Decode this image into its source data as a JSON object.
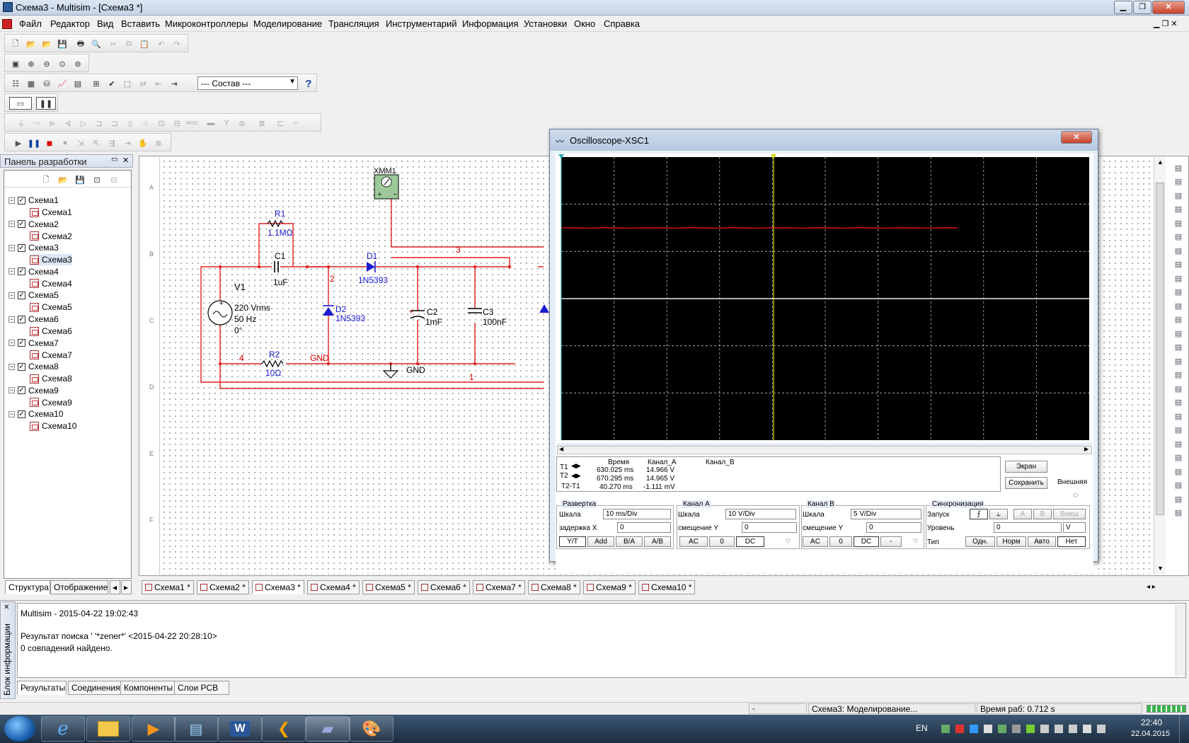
{
  "window": {
    "title": "Схема3 - Multisim - [Схема3 *]"
  },
  "menu": [
    "Файл",
    "Редактор",
    "Вид",
    "Вставить",
    "Микроконтроллеры",
    "Моделирование",
    "Трансляция",
    "Инструментарий",
    "Информация",
    "Установки",
    "Окно",
    "Справка"
  ],
  "toolbar": {
    "usage_select": "--- Состав ---"
  },
  "design_panel": {
    "title": "Панель разработки",
    "items": [
      {
        "parent": "Схема1",
        "child": "Схема1"
      },
      {
        "parent": "Схема2",
        "child": "Схема2"
      },
      {
        "parent": "Схема3",
        "child": "Схема3"
      },
      {
        "parent": "Схема4",
        "child": "Схема4"
      },
      {
        "parent": "Схема5",
        "child": "Схема5"
      },
      {
        "parent": "Схема6",
        "child": "Схема6"
      },
      {
        "parent": "Схема7",
        "child": "Схема7"
      },
      {
        "parent": "Схема8",
        "child": "Схема8"
      },
      {
        "parent": "Схема9",
        "child": "Схема9"
      },
      {
        "parent": "Схема10",
        "child": "Схема10"
      }
    ],
    "tabs": [
      "Структура",
      "Отображение"
    ]
  },
  "schematic": {
    "xmm": "XMM1",
    "r1_name": "R1",
    "r1_val": "1.1MΩ",
    "c1_name": "C1",
    "c1_val": "1uF",
    "d1_name": "D1",
    "d1_val": "1N5393",
    "v1_name": "V1",
    "v1_l1": "220 Vrms",
    "v1_l2": "50 Hz",
    "v1_l3": "0°",
    "d2_name": "D2",
    "d2_val": "1N5393",
    "c2_name": "C2",
    "c2_val": "1mF",
    "c3_name": "C3",
    "c3_val": "100nF",
    "r2_name": "R2",
    "r2_val": "10Ω",
    "gnd": "GND",
    "gnd_net": "GND",
    "net2": "2",
    "net3": "3",
    "net4": "4",
    "net1": "1",
    "c2_plus": "+",
    "ruler": [
      "A",
      "B",
      "C",
      "D",
      "E",
      "F"
    ]
  },
  "doc_tabs": [
    "Схема1 *",
    "Схема2 *",
    "Схема3 *",
    "Схема4 *",
    "Схема5 *",
    "Схема6 *",
    "Схема7 *",
    "Схема8 *",
    "Схема9 *",
    "Схема10 *"
  ],
  "active_doc_tab": 2,
  "oscilloscope": {
    "title": "Oscilloscope-XSC1",
    "readout": {
      "hdr_time": "Время",
      "hdr_a": "Канал_A",
      "hdr_b": "Канал_B",
      "t1_time": "630.025 ms",
      "t1_a": "14.966 V",
      "t2_time": "670.295 ms",
      "t2_a": "14.965 V",
      "dt_time": "40.270 ms",
      "dt_a": "-1.111 mV",
      "t1": "T1",
      "t2": "T2",
      "dt": "T2-T1"
    },
    "btn_screen": "Экран",
    "btn_save": "Сохранить",
    "ext_label": "Внешняя",
    "timebase": {
      "title": "Развертка",
      "scale_label": "Шкала",
      "scale": "10 ms/Div",
      "delay_label": "задержка X",
      "delay": "0",
      "btns": [
        "Y/T",
        "Add",
        "B/A",
        "A/B"
      ]
    },
    "chA": {
      "title": "Канал А",
      "scale_label": "Шкала",
      "scale": "10  V/Div",
      "offset_label": "смещение Y",
      "offset": "0",
      "btns": [
        "AC",
        "0",
        "DC"
      ]
    },
    "chB": {
      "title": "Канал В",
      "scale_label": "Шкала",
      "scale": "5  V/Div",
      "offset_label": "смещение Y",
      "offset": "0",
      "btns": [
        "AC",
        "0",
        "DC",
        "-"
      ]
    },
    "trigger": {
      "title": "Синхронизация",
      "edge_label": "Запуск",
      "level_label": "Уровень",
      "level": "0",
      "unit": "V",
      "type_label": "Тип",
      "src": [
        "A",
        "B",
        "Внеш"
      ],
      "types": [
        "Одн.",
        "Норм",
        "Авто",
        "Нет"
      ]
    },
    "trace": {
      "channel_a_level_divs": 1.5,
      "channel_b_level_divs": 0,
      "color_a": "#cc1111"
    }
  },
  "spreadsheet": {
    "side_label": "Блок информации",
    "lines": [
      "Multisim  -  2015-04-22 19:02:43",
      "",
      "Результат поиска ' '*zener*'  <2015-04-22 20:28:10>",
      "0 совпадений найдено."
    ],
    "tabs": [
      "Результаты",
      "Соединения",
      "Компоненты",
      "Слои PCB"
    ]
  },
  "statusbar": {
    "s1": "-",
    "s2": "Схема3: Моделирование...",
    "s3": "Время раб: 0.712 s"
  },
  "taskbar": {
    "lang": "EN",
    "time": "22:40",
    "date": "22.04.2015"
  }
}
